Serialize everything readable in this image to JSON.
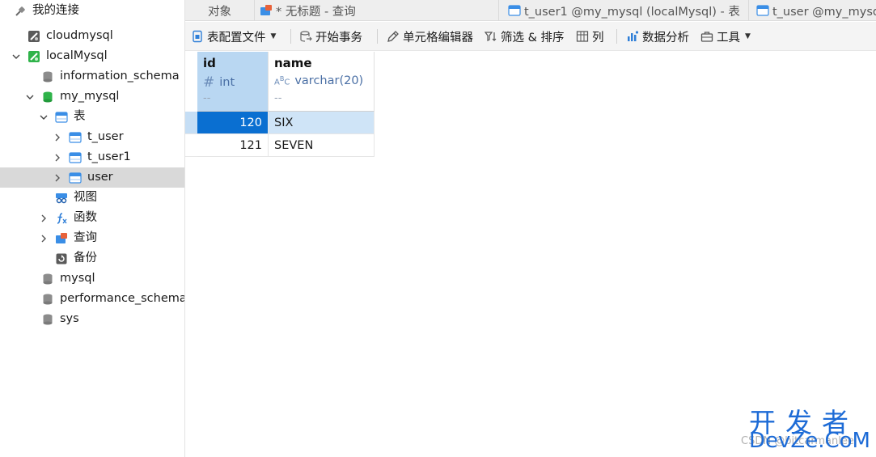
{
  "sidebar": {
    "root_label": "我的连接",
    "items": {
      "cloudmysql": "cloudmysql",
      "localmysql": "localMysql",
      "information_schema": "information_schema",
      "my_mysql": "my_mysql",
      "tables": "表",
      "t_user": "t_user",
      "t_user1": "t_user1",
      "user": "user",
      "views": "视图",
      "functions": "函数",
      "queries": "查询",
      "backups": "备份",
      "mysql": "mysql",
      "performance_schema": "performance_schema",
      "sys": "sys"
    }
  },
  "tabs": {
    "objects": "对象",
    "untitled_query": "* 无标题 - 查询",
    "t_user1": "t_user1 @my_mysql (localMysql) - 表",
    "t_user": "t_user @my_mysql (localMysql) - 表"
  },
  "toolbar": {
    "table_config": "表配置文件",
    "begin_transaction": "开始事务",
    "cell_editor": "单元格编辑器",
    "filter_sort": "筛选 & 排序",
    "columns": "列",
    "data_analysis": "数据分析",
    "tools": "工具"
  },
  "grid": {
    "columns": [
      {
        "name": "id",
        "type": "int",
        "default": "--"
      },
      {
        "name": "name",
        "type": "varchar(20)",
        "default": "--"
      }
    ],
    "rows": [
      {
        "id": "120",
        "name": "SIX"
      },
      {
        "id": "121",
        "name": "SEVEN"
      }
    ]
  },
  "watermark": {
    "top": "开发者",
    "bottom": "DevZe.CoM",
    "sub": "CSDN @bitcarmanlee"
  },
  "colors": {
    "accent": "#0a6fd1",
    "selected_header": "#b9d7f2",
    "selected_row": "#cfe4f7",
    "tree_selected": "#d9d9d9"
  }
}
